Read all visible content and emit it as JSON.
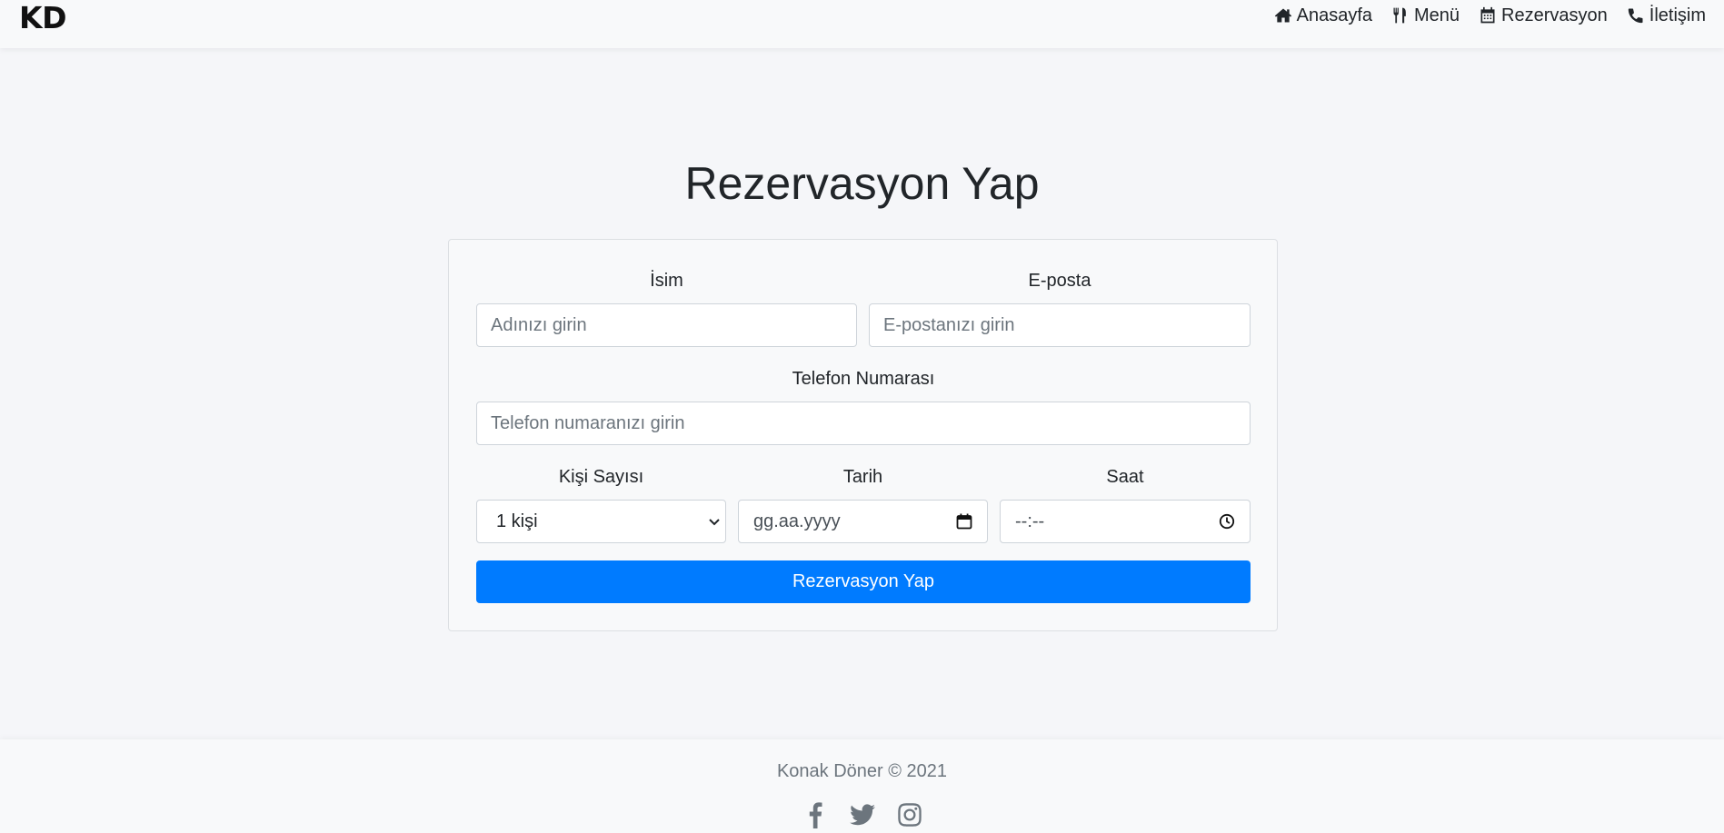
{
  "brand": "KD",
  "nav": {
    "items": [
      {
        "label": "Anasayfa",
        "icon": "home-icon"
      },
      {
        "label": "Menü",
        "icon": "utensils-icon"
      },
      {
        "label": "Rezervasyon",
        "icon": "calendar-icon"
      },
      {
        "label": "İletişim",
        "icon": "phone-icon"
      }
    ]
  },
  "page": {
    "title": "Rezervasyon Yap"
  },
  "form": {
    "name_label": "İsim",
    "name_placeholder": "Adınızı girin",
    "email_label": "E-posta",
    "email_placeholder": "E-postanızı girin",
    "phone_label": "Telefon Numarası",
    "phone_placeholder": "Telefon numaranızı girin",
    "guests_label": "Kişi Sayısı",
    "guests_value": "1 kişi",
    "date_label": "Tarih",
    "date_value": "gg.aa.yyyy",
    "time_label": "Saat",
    "time_value": "--:--",
    "submit_label": "Rezervasyon Yap"
  },
  "footer": {
    "copyright": "Konak Döner © 2021",
    "socials": [
      "facebook-icon",
      "twitter-icon",
      "instagram-icon"
    ]
  },
  "colors": {
    "primary": "#007bff",
    "background": "#f5f6f9",
    "navbar": "#f8f9fa",
    "muted_text": "#6c757d"
  }
}
